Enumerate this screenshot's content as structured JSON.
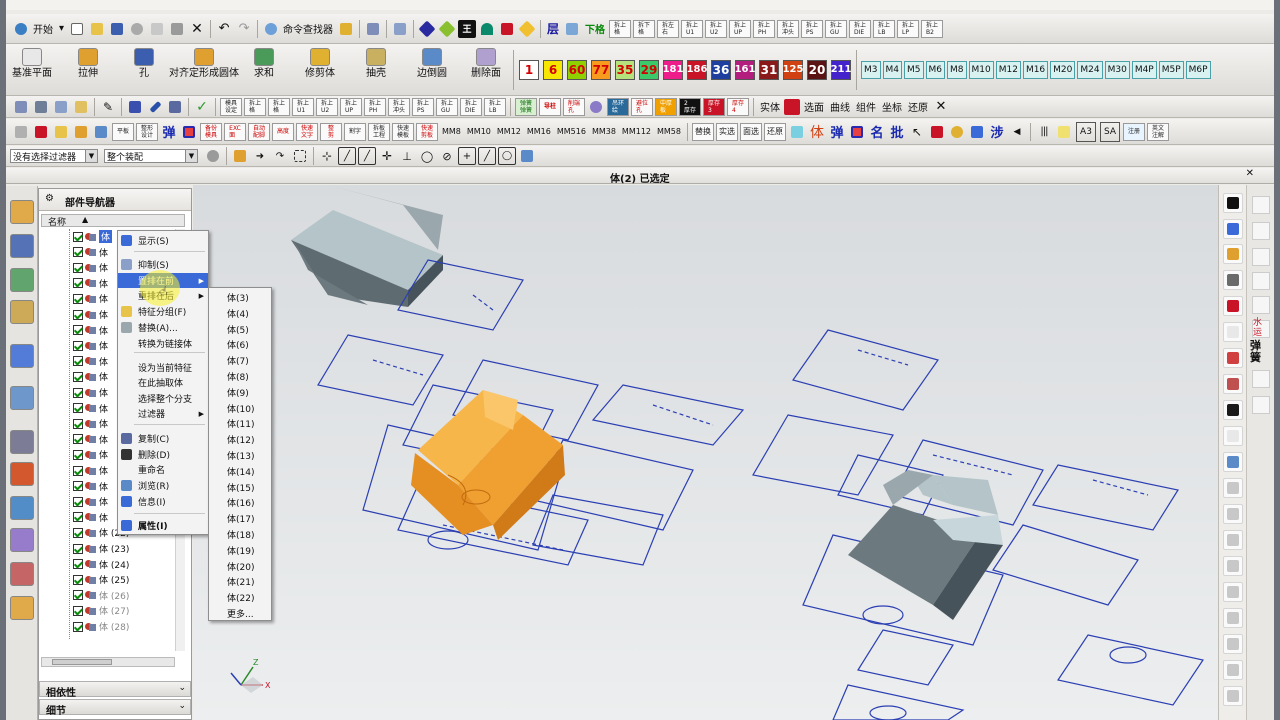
{
  "toolbar_row1": {
    "start_label": "开始",
    "cmd_finder": "命令查找器",
    "layer_label": "层",
    "tab_label": "下格",
    "mini_buttons": [
      "拆上\n格",
      "拆下\n格",
      "拆左\n右",
      "拆上\nU1",
      "拆上\nU2",
      "拆上\nUP",
      "拆上\nPH",
      "拆上\n冲头",
      "拆上\nPS",
      "拆上\nGU",
      "拆上\nDIE",
      "拆上\nLB",
      "拆上\nLP",
      "拆上\nB2"
    ]
  },
  "toolbar_row2": {
    "big_buttons": [
      "基准平面",
      "拉伸",
      "孔",
      "对齐定形成圆体",
      "求和",
      "修剪体",
      "抽壳",
      "边倒圆",
      "删除面"
    ],
    "color_numbers": [
      {
        "label": "1",
        "bg": "#ffffff",
        "fg": "#d40000"
      },
      {
        "label": "6",
        "bg": "#f6e600",
        "fg": "#d40000"
      },
      {
        "label": "60",
        "bg": "#8fd000",
        "fg": "#d40000"
      },
      {
        "label": "77",
        "bg": "#f89a1e",
        "fg": "#d40000"
      },
      {
        "label": "35",
        "bg": "#b6e27c",
        "fg": "#d40000"
      },
      {
        "label": "29",
        "bg": "#3cc96a",
        "fg": "#d40000"
      },
      {
        "label": "181",
        "bg": "#ee1b8a",
        "fg": "#ffffff"
      },
      {
        "label": "186",
        "bg": "#c81426",
        "fg": "#ffffff"
      },
      {
        "label": "36",
        "bg": "#1f3f9e",
        "fg": "#ffffff"
      },
      {
        "label": "161",
        "bg": "#b21d7e",
        "fg": "#ffffff"
      },
      {
        "label": "31",
        "bg": "#8a1a1a",
        "fg": "#ffffff"
      },
      {
        "label": "125",
        "bg": "#d04010",
        "fg": "#ffffff"
      },
      {
        "label": "20",
        "bg": "#5b1212",
        "fg": "#ffffff"
      },
      {
        "label": "211",
        "bg": "#4422cc",
        "fg": "#ffffff"
      }
    ],
    "m_buttons": [
      "M3",
      "M4",
      "M5",
      "M6",
      "M8",
      "M10",
      "M12",
      "M16",
      "M20",
      "M24",
      "M30",
      "M4P",
      "M5P",
      "M6P"
    ]
  },
  "toolbar_row3": {
    "mini_buttons": [
      "模具\n设定",
      "拆上\n格",
      "拆上\n格",
      "拆上\nU1",
      "拆上\nU2",
      "拆上\nUP",
      "拆上\nPH",
      "拆上\n冲头",
      "拆上\nPS",
      "拆上\nGU",
      "拆上\nDIE",
      "拆上\nLB"
    ],
    "right_labels": [
      "实体",
      "选面",
      "曲线",
      "组件",
      "坐标",
      "还原"
    ]
  },
  "toolbar_row4": {
    "mm_labels": [
      "MM8",
      "MM10",
      "MM12",
      "MM16",
      "MM516",
      "MM38",
      "MM112",
      "MM58"
    ],
    "cn_buttons": [
      "替换",
      "实选",
      "面选",
      "还原"
    ],
    "right_marks": [
      "A3",
      "SA"
    ]
  },
  "filter_bar": {
    "filter": "没有选择过滤器",
    "assembly": "整个装配"
  },
  "status": {
    "selection": "体(2) 已选定"
  },
  "navigator": {
    "title": "部件导航器",
    "column": "名称",
    "rows": [
      "体",
      "体",
      "体",
      "体",
      "体",
      "体",
      "体",
      "体",
      "体",
      "体",
      "体",
      "体",
      "体",
      "体",
      "体",
      "体",
      "体",
      "体",
      "体",
      "体 (22)",
      "体 (23)",
      "体 (24)",
      "体 (25)",
      "体 (26)",
      "体 (27)",
      "体 (28)"
    ],
    "dependency": "相依性",
    "details": "细节"
  },
  "context_menu": {
    "items": [
      "显示(S)",
      "抑制(S)",
      "置排在前",
      "重排在后",
      "特征分组(F)",
      "替换(A)...",
      "转换为链接体",
      "设为当前特征",
      "在此抽取体",
      "选择整个分支",
      "过滤器",
      "复制(C)",
      "删除(D)",
      "重命名",
      "浏览(R)",
      "信息(I)",
      "属性(I)"
    ]
  },
  "submenu": {
    "items": [
      "体(3)",
      "体(4)",
      "体(5)",
      "体(6)",
      "体(7)",
      "体(8)",
      "体(9)",
      "体(10)",
      "体(11)",
      "体(12)",
      "体(13)",
      "体(14)",
      "体(15)",
      "体(16)",
      "体(17)",
      "体(18)",
      "体(19)",
      "体(20)",
      "体(21)",
      "体(22)",
      "更多..."
    ]
  },
  "right_toolbar": {
    "labels": [
      "打",
      "弹",
      "簧",
      "水",
      "运"
    ]
  },
  "triad": {
    "z": "Z",
    "y": "Y",
    "x": "X"
  },
  "colors": {
    "accent_orange": "#f0a030",
    "wire_blue": "#2b3fb3",
    "solid_gray": "#6c7a80"
  }
}
